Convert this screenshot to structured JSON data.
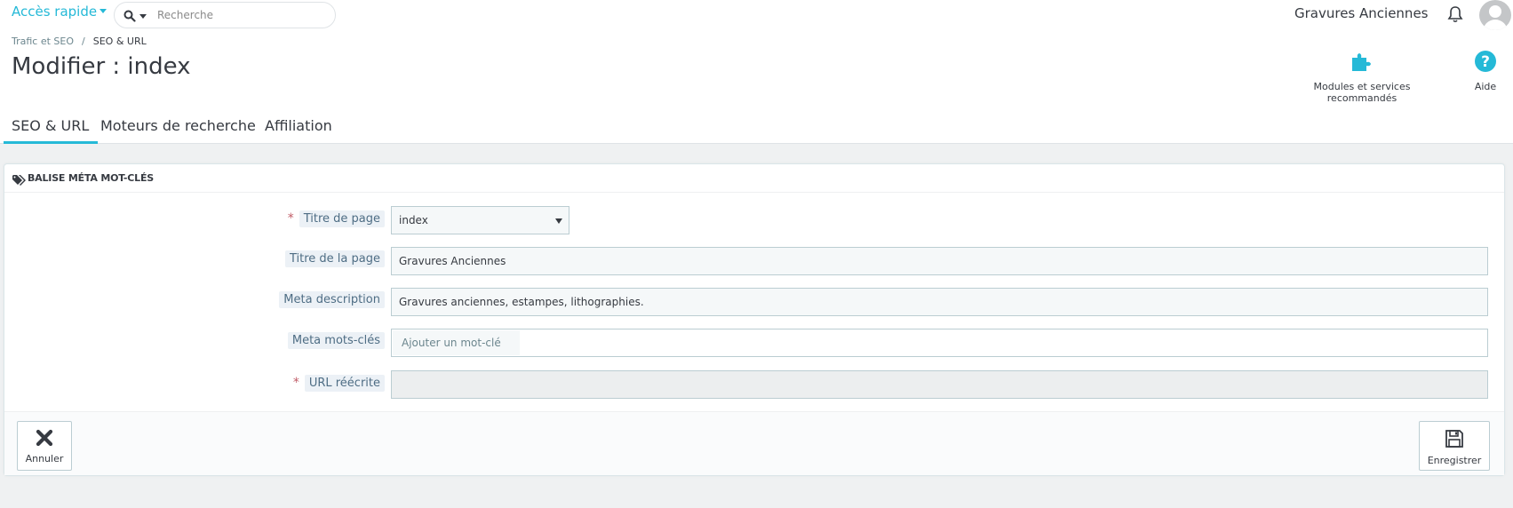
{
  "header": {
    "quick_access": "Accès rapide",
    "search_placeholder": "Recherche",
    "shop_name": "Gravures Anciennes"
  },
  "breadcrumb": {
    "parent": "Trafic et SEO",
    "separator": "/",
    "current": "SEO & URL"
  },
  "page_title": "Modifier : index",
  "toolbar": {
    "modules_label": "Modules et services recommandés",
    "help_label": "Aide"
  },
  "tabs": [
    {
      "label": "SEO & URL",
      "active": true
    },
    {
      "label": "Moteurs de recherche",
      "active": false
    },
    {
      "label": "Affiliation",
      "active": false
    }
  ],
  "panel": {
    "title": "BALISE MÉTA MOT-CLÉS",
    "fields": {
      "page": {
        "label": "Titre de page",
        "required": true,
        "value": "index"
      },
      "page_title": {
        "label": "Titre de la page",
        "required": false,
        "value": "Gravures Anciennes"
      },
      "meta_description": {
        "label": "Meta description",
        "required": false,
        "value": "Gravures anciennes, estampes, lithographies."
      },
      "meta_keywords": {
        "label": "Meta mots-clés",
        "required": false,
        "placeholder": "Ajouter un mot-clé"
      },
      "rewritten_url": {
        "label": "URL réécrite",
        "required": true,
        "value": ""
      }
    },
    "required_mark": "*",
    "cancel_label": "Annuler",
    "save_label": "Enregistrer"
  },
  "colors": {
    "accent": "#25b9d7",
    "text": "#363a41",
    "background": "#eff1f2",
    "required": "#c05c67"
  }
}
